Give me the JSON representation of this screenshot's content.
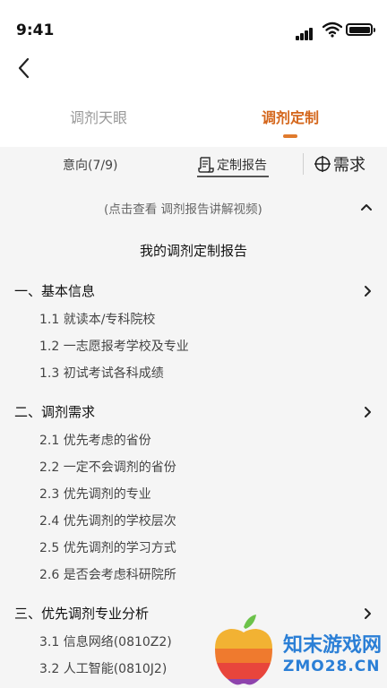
{
  "status": {
    "time": "9:41"
  },
  "tabs": [
    {
      "label": "调剂天眼"
    },
    {
      "label": "调剂定制"
    }
  ],
  "subbar": {
    "intent": "意向(7/9)",
    "report": "定制报告",
    "need": "需求"
  },
  "hint": "(点击查看 调剂报告讲解视频)",
  "report_title": "我的调剂定制报告",
  "sections": [
    {
      "title": "一、基本信息",
      "items": [
        "1.1 就读本/专科院校",
        "1.2 一志愿报考学校及专业",
        "1.3 初试考试各科成绩"
      ]
    },
    {
      "title": "二、调剂需求",
      "items": [
        "2.1 优先考虑的省份",
        "2.2 一定不会调剂的省份",
        "2.3 优先调剂的专业",
        "2.4 优先调剂的学校层次",
        "2.5 优先调剂的学习方式",
        "2.6 是否会考虑科研院所"
      ]
    },
    {
      "title": "三、优先调剂专业分析",
      "items": [
        "3.1 信息网络(0810Z2)",
        "3.2 人工智能(0810J2)"
      ]
    }
  ],
  "watermark": {
    "line1": "知末游戏网",
    "line2": "ZMO28.CN"
  },
  "colors": {
    "accent": "#d4661b",
    "background": "#f5f5f5",
    "watermark": "#2b7fd6"
  }
}
